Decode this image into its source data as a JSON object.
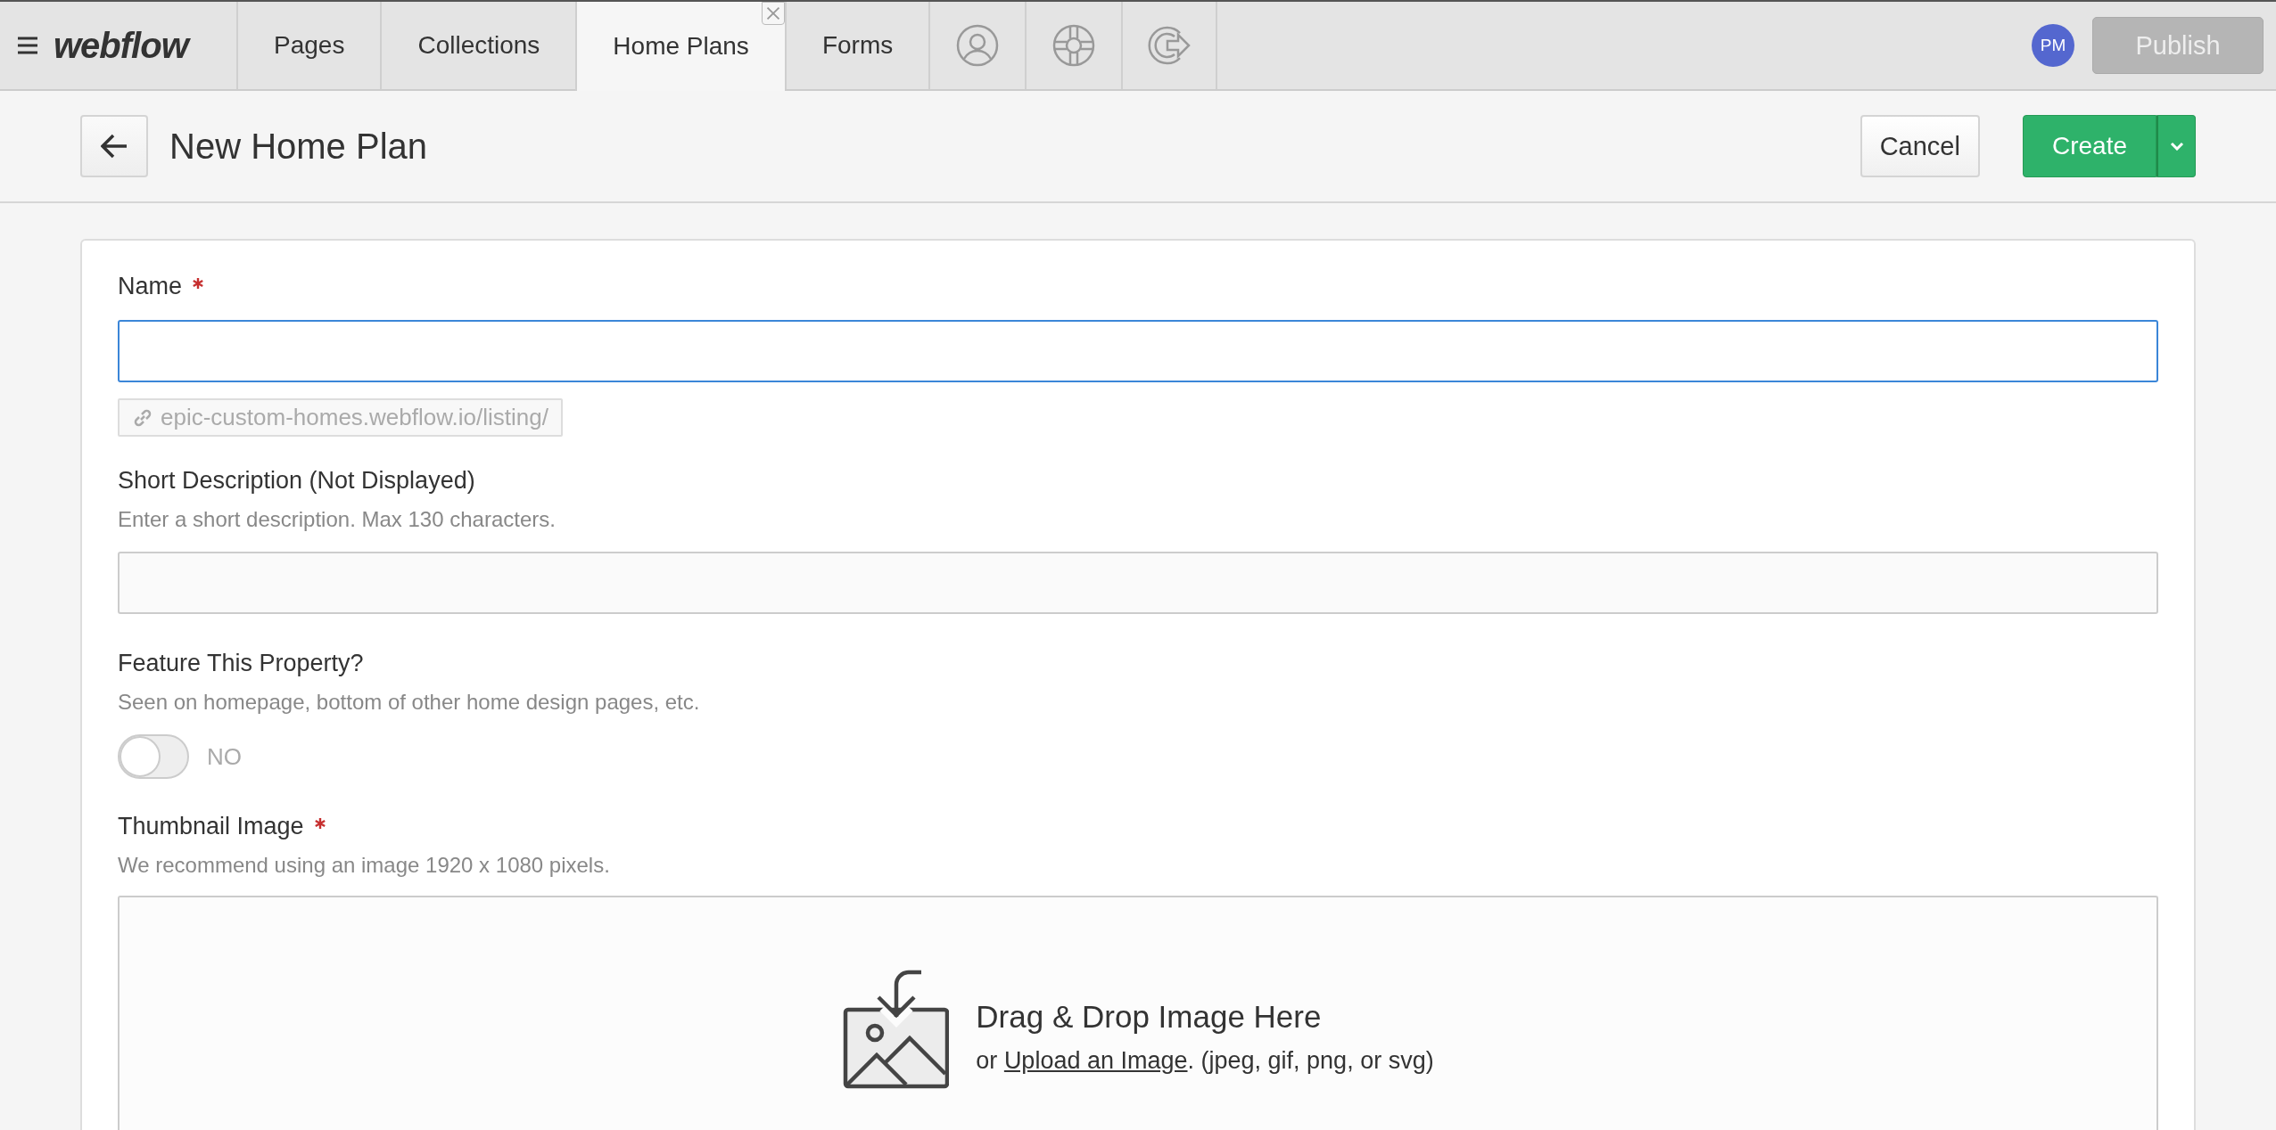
{
  "nav": {
    "logo": "webflow",
    "tabs": [
      {
        "label": "Pages",
        "selected": false
      },
      {
        "label": "Collections",
        "selected": false
      },
      {
        "label": "Home Plans",
        "selected": true,
        "closable": true
      },
      {
        "label": "Forms",
        "selected": false
      }
    ],
    "icon_tabs": [
      {
        "selected": false
      },
      {
        "selected": false
      },
      {
        "selected": false
      }
    ],
    "avatar": "PM",
    "publish": {
      "label": "Publish",
      "disabled": true
    }
  },
  "header": {
    "title": "New Home Plan",
    "cancel": "Cancel",
    "create": "Create"
  },
  "fields": [
    {
      "kind": "text",
      "label": "Name",
      "required": true,
      "focused": true,
      "slug": "epic-custom-homes.webflow.io/listing/"
    },
    {
      "kind": "text",
      "label": "Short Description (Not Displayed)",
      "required": false,
      "focused": false,
      "hint": "Enter a short description. Max 130 characters."
    },
    {
      "kind": "switch",
      "label": "Feature This Property?",
      "required": false,
      "hint": "Seen on homepage, bottom of other home design pages, etc.",
      "on": false,
      "state_label": "NO"
    },
    {
      "kind": "image",
      "label": "Thumbnail Image",
      "required": true,
      "hint": "We recommend using an image 1920 x 1080 pixels.",
      "drop_title": "Drag & Drop Image Here",
      "drop_prefix": "or",
      "drop_link": "Upload an Image",
      "drop_suffix": ". (jpeg, gif, png, or svg)"
    }
  ]
}
